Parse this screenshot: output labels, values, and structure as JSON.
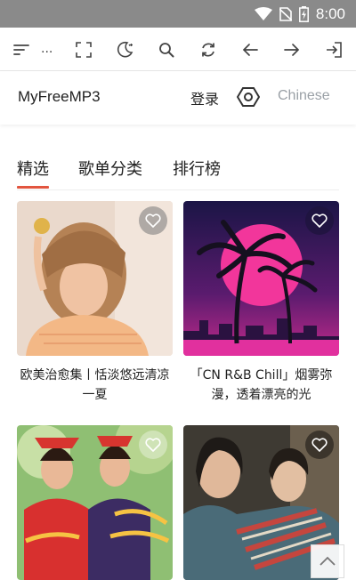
{
  "status_bar": {
    "time": "8:00"
  },
  "toolbar": {
    "overflow_text": "..."
  },
  "site": {
    "brand": "MyFreeMP3",
    "login": "登录",
    "language": "Chinese"
  },
  "tabs": [
    {
      "label": "精选"
    },
    {
      "label": "歌单分类"
    },
    {
      "label": "排行榜"
    }
  ],
  "playlists": [
    {
      "title": "欧美治愈集丨恬淡悠远清凉一夏"
    },
    {
      "title": "「CN R&B Chill」烟雾弥漫，透着漂亮的光"
    },
    {
      "title": ""
    },
    {
      "title": ""
    }
  ],
  "colors": {
    "accent": "#e2553f",
    "status_bar": "#8a8a8a",
    "language_text": "#9aa0a6"
  }
}
